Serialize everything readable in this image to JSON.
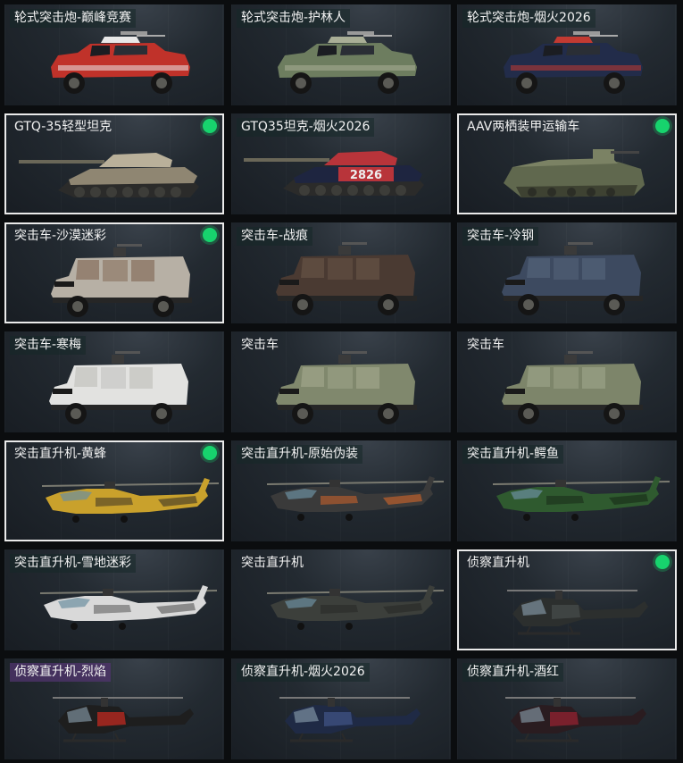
{
  "cards": [
    {
      "label": "轮式突击炮-巅峰竞赛",
      "kind": "wheeled",
      "body": "#c0322a",
      "accent": "#e8e8e8",
      "selected": false,
      "owned": false,
      "tag": "teal"
    },
    {
      "label": "轮式突击炮-护林人",
      "kind": "wheeled",
      "body": "#6d7d5f",
      "accent": "#a9ae96",
      "selected": false,
      "owned": false,
      "tag": "teal"
    },
    {
      "label": "轮式突击炮-烟火2026",
      "kind": "wheeled",
      "body": "#222c4a",
      "accent": "#c23a32",
      "selected": false,
      "owned": false,
      "tag": "teal"
    },
    {
      "label": "GTQ-35轻型坦克",
      "kind": "tank",
      "body": "#8f8672",
      "accent": "#b9b09a",
      "selected": true,
      "owned": true,
      "tag": "teal"
    },
    {
      "label": "GTQ35坦克-烟火2026",
      "kind": "tank2",
      "body": "#1e2540",
      "accent": "#b8343a",
      "selected": false,
      "owned": false,
      "tag": "teal",
      "decal": "2826"
    },
    {
      "label": "AAV两栖装甲运输车",
      "kind": "aav",
      "body": "#60684e",
      "accent": "#7b8264",
      "selected": true,
      "owned": true,
      "tag": "teal"
    },
    {
      "label": "突击车-沙漠迷彩",
      "kind": "truck",
      "body": "#b7b0a5",
      "accent": "#7a5d48",
      "selected": true,
      "owned": true,
      "tag": "teal"
    },
    {
      "label": "突击车-战痕",
      "kind": "truck",
      "body": "#4a3a32",
      "accent": "#6e5a4b",
      "selected": false,
      "owned": false,
      "tag": "teal"
    },
    {
      "label": "突击车-冷钢",
      "kind": "truck",
      "body": "#3d4a60",
      "accent": "#5a6a80",
      "selected": false,
      "owned": false,
      "tag": "teal"
    },
    {
      "label": "突击车-寒梅",
      "kind": "truck",
      "body": "#e2e2e0",
      "accent": "#b9b9b5",
      "selected": false,
      "owned": false,
      "tag": "teal"
    },
    {
      "label": "突击车",
      "kind": "truck",
      "body": "#80886d",
      "accent": "#a7ad91",
      "selected": false,
      "owned": false,
      "tag": "none"
    },
    {
      "label": "突击车",
      "kind": "truck",
      "body": "#7d856a",
      "accent": "#a3a98e",
      "selected": false,
      "owned": false,
      "tag": "none"
    },
    {
      "label": "突击直升机-黄蜂",
      "kind": "heli",
      "body": "#c9a12c",
      "accent": "#3a3326",
      "selected": true,
      "owned": true,
      "tag": "teal"
    },
    {
      "label": "突击直升机-原始伪装",
      "kind": "heli",
      "body": "#3a3a3a",
      "accent": "#d2652a",
      "selected": false,
      "owned": false,
      "tag": "teal"
    },
    {
      "label": "突击直升机-鳄鱼",
      "kind": "heli",
      "body": "#2f5a2f",
      "accent": "#182a18",
      "selected": false,
      "owned": false,
      "tag": "teal"
    },
    {
      "label": "突击直升机-雪地迷彩",
      "kind": "heli",
      "body": "#d9d9d9",
      "accent": "#555",
      "selected": false,
      "owned": false,
      "tag": "teal"
    },
    {
      "label": "突击直升机",
      "kind": "heli",
      "body": "#3c3f3b",
      "accent": "#262826",
      "selected": false,
      "owned": false,
      "tag": "none"
    },
    {
      "label": "侦察直升机",
      "kind": "scout",
      "body": "#2c2f2e",
      "accent": "#454a48",
      "selected": true,
      "owned": true,
      "tag": "none"
    },
    {
      "label": "侦察直升机-烈焰",
      "kind": "scout",
      "body": "#1e1e1e",
      "accent": "#b5281f",
      "selected": false,
      "owned": false,
      "tag": "purple"
    },
    {
      "label": "侦察直升机-烟火2026",
      "kind": "scout",
      "body": "#1f2a45",
      "accent": "#3d5080",
      "selected": false,
      "owned": false,
      "tag": "teal"
    },
    {
      "label": "侦察直升机-酒红",
      "kind": "scout",
      "body": "#2a1c20",
      "accent": "#8d2230",
      "selected": false,
      "owned": false,
      "tag": "teal"
    }
  ]
}
